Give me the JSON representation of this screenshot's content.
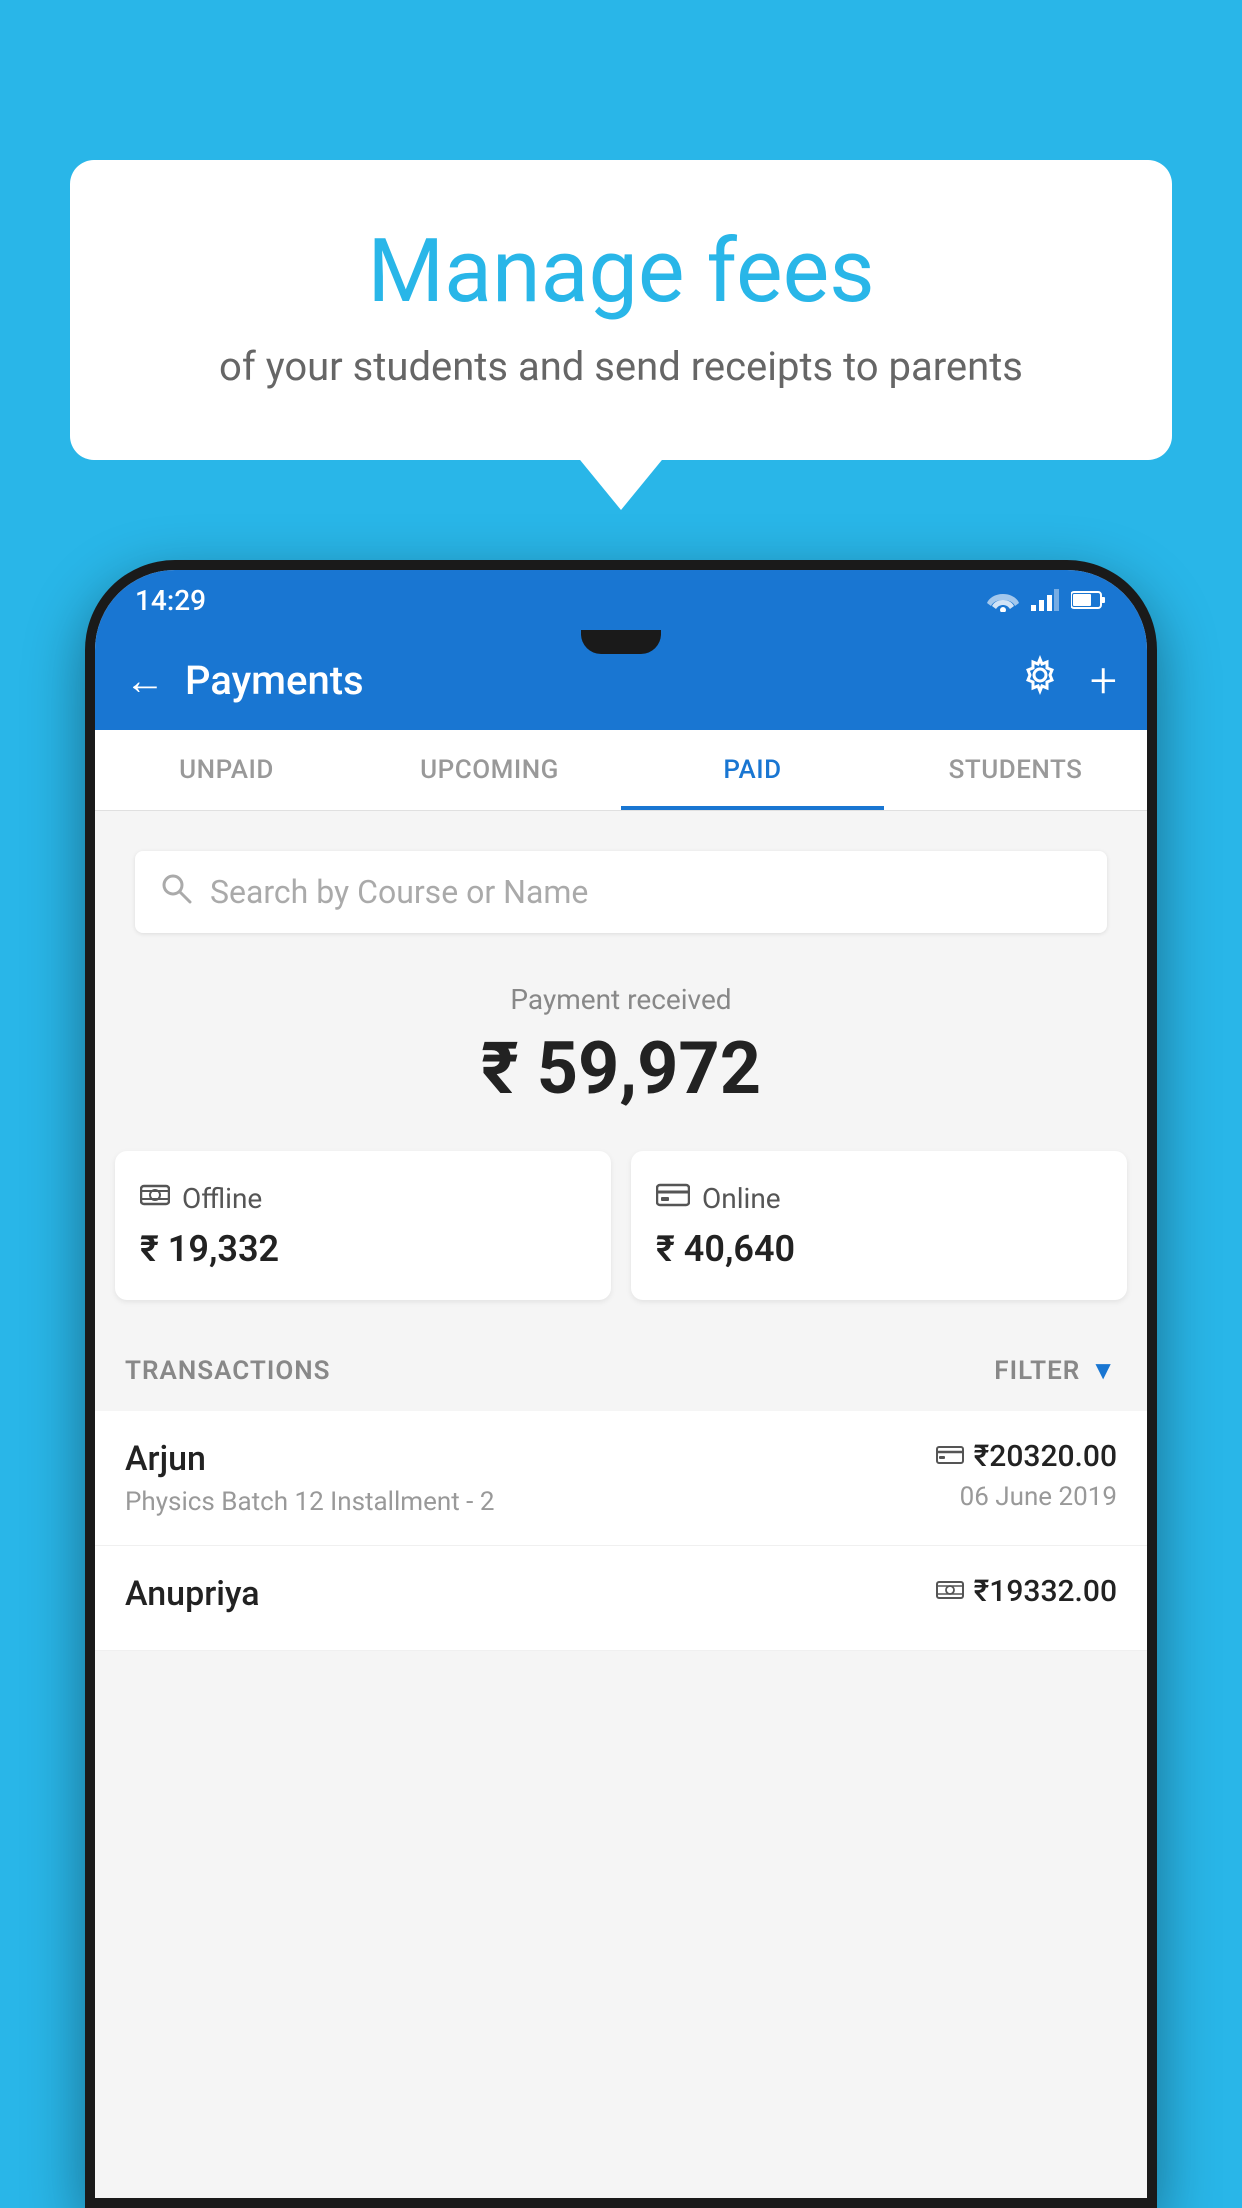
{
  "background_color": "#29b6e8",
  "bubble": {
    "title": "Manage fees",
    "subtitle": "of your students and send receipts to parents"
  },
  "status_bar": {
    "time": "14:29"
  },
  "app_bar": {
    "title": "Payments",
    "back_label": "←",
    "settings_label": "⚙",
    "add_label": "+"
  },
  "tabs": [
    {
      "label": "UNPAID",
      "active": false
    },
    {
      "label": "UPCOMING",
      "active": false
    },
    {
      "label": "PAID",
      "active": true
    },
    {
      "label": "STUDENTS",
      "active": false
    }
  ],
  "search": {
    "placeholder": "Search by Course or Name"
  },
  "payment_summary": {
    "label": "Payment received",
    "amount": "₹ 59,972"
  },
  "payment_cards": [
    {
      "type": "Offline",
      "amount": "₹ 19,332",
      "icon": "offline"
    },
    {
      "type": "Online",
      "amount": "₹ 40,640",
      "icon": "online"
    }
  ],
  "transactions_section": {
    "label": "TRANSACTIONS",
    "filter_label": "FILTER"
  },
  "transactions": [
    {
      "name": "Arjun",
      "detail": "Physics Batch 12 Installment - 2",
      "amount": "₹20320.00",
      "date": "06 June 2019",
      "payment_type": "online"
    },
    {
      "name": "Anupriya",
      "detail": "",
      "amount": "₹19332.00",
      "date": "",
      "payment_type": "offline"
    }
  ]
}
